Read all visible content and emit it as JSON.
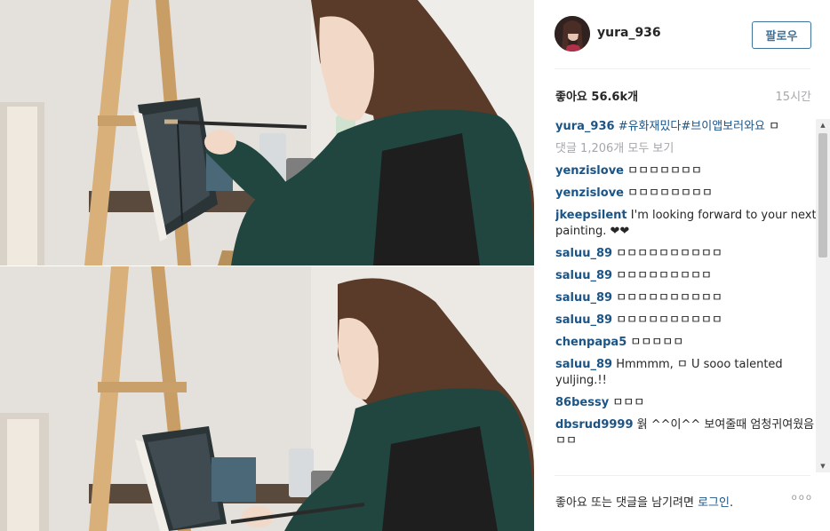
{
  "post": {
    "username": "yura_936",
    "follow_label": "팔로우",
    "likes": "좋아요 56.6k개",
    "time_ago": "15시간",
    "caption": {
      "username": "yura_936",
      "text": "#유화재밌다#브이앱보러와요",
      "tail": "ㅁ"
    },
    "view_all": "댓글 1,206개 모두 보기"
  },
  "comments": [
    {
      "user": "yenzislove",
      "text": "ㅁㅁㅁㅁㅁㅁㅁ"
    },
    {
      "user": "yenzislove",
      "text": "ㅁㅁㅁㅁㅁㅁㅁㅁ"
    },
    {
      "user": "jkeepsilent",
      "text": "I'm looking forward to your next painting. ❤❤"
    },
    {
      "user": "saluu_89",
      "text": "ㅁㅁㅁㅁㅁㅁㅁㅁㅁㅁ"
    },
    {
      "user": "saluu_89",
      "text": "ㅁㅁㅁㅁㅁㅁㅁㅁㅁ"
    },
    {
      "user": "saluu_89",
      "text": "ㅁㅁㅁㅁㅁㅁㅁㅁㅁㅁ"
    },
    {
      "user": "saluu_89",
      "text": "ㅁㅁㅁㅁㅁㅁㅁㅁㅁㅁ"
    },
    {
      "user": "chenpapa5",
      "text": "ㅁㅁㅁㅁㅁ"
    },
    {
      "user": "saluu_89",
      "text": "Hmmmm, ㅁ U sooo talented yuljing.!!"
    },
    {
      "user": "86bessy",
      "text": "ㅁㅁㅁ"
    },
    {
      "user": "dbsrud9999",
      "text": "웕 ^^이^^ 보여줄때 엄청귀여웠음ㅁㅁ"
    }
  ],
  "footer": {
    "prompt": "좋아요 또는 댓글을 남기려면 ",
    "login_label": "로그인",
    "period": ".",
    "more_label": "ooo"
  },
  "colors": {
    "link": "#1b5486",
    "button_border": "#3f729b",
    "muted": "#a5a7aa"
  }
}
